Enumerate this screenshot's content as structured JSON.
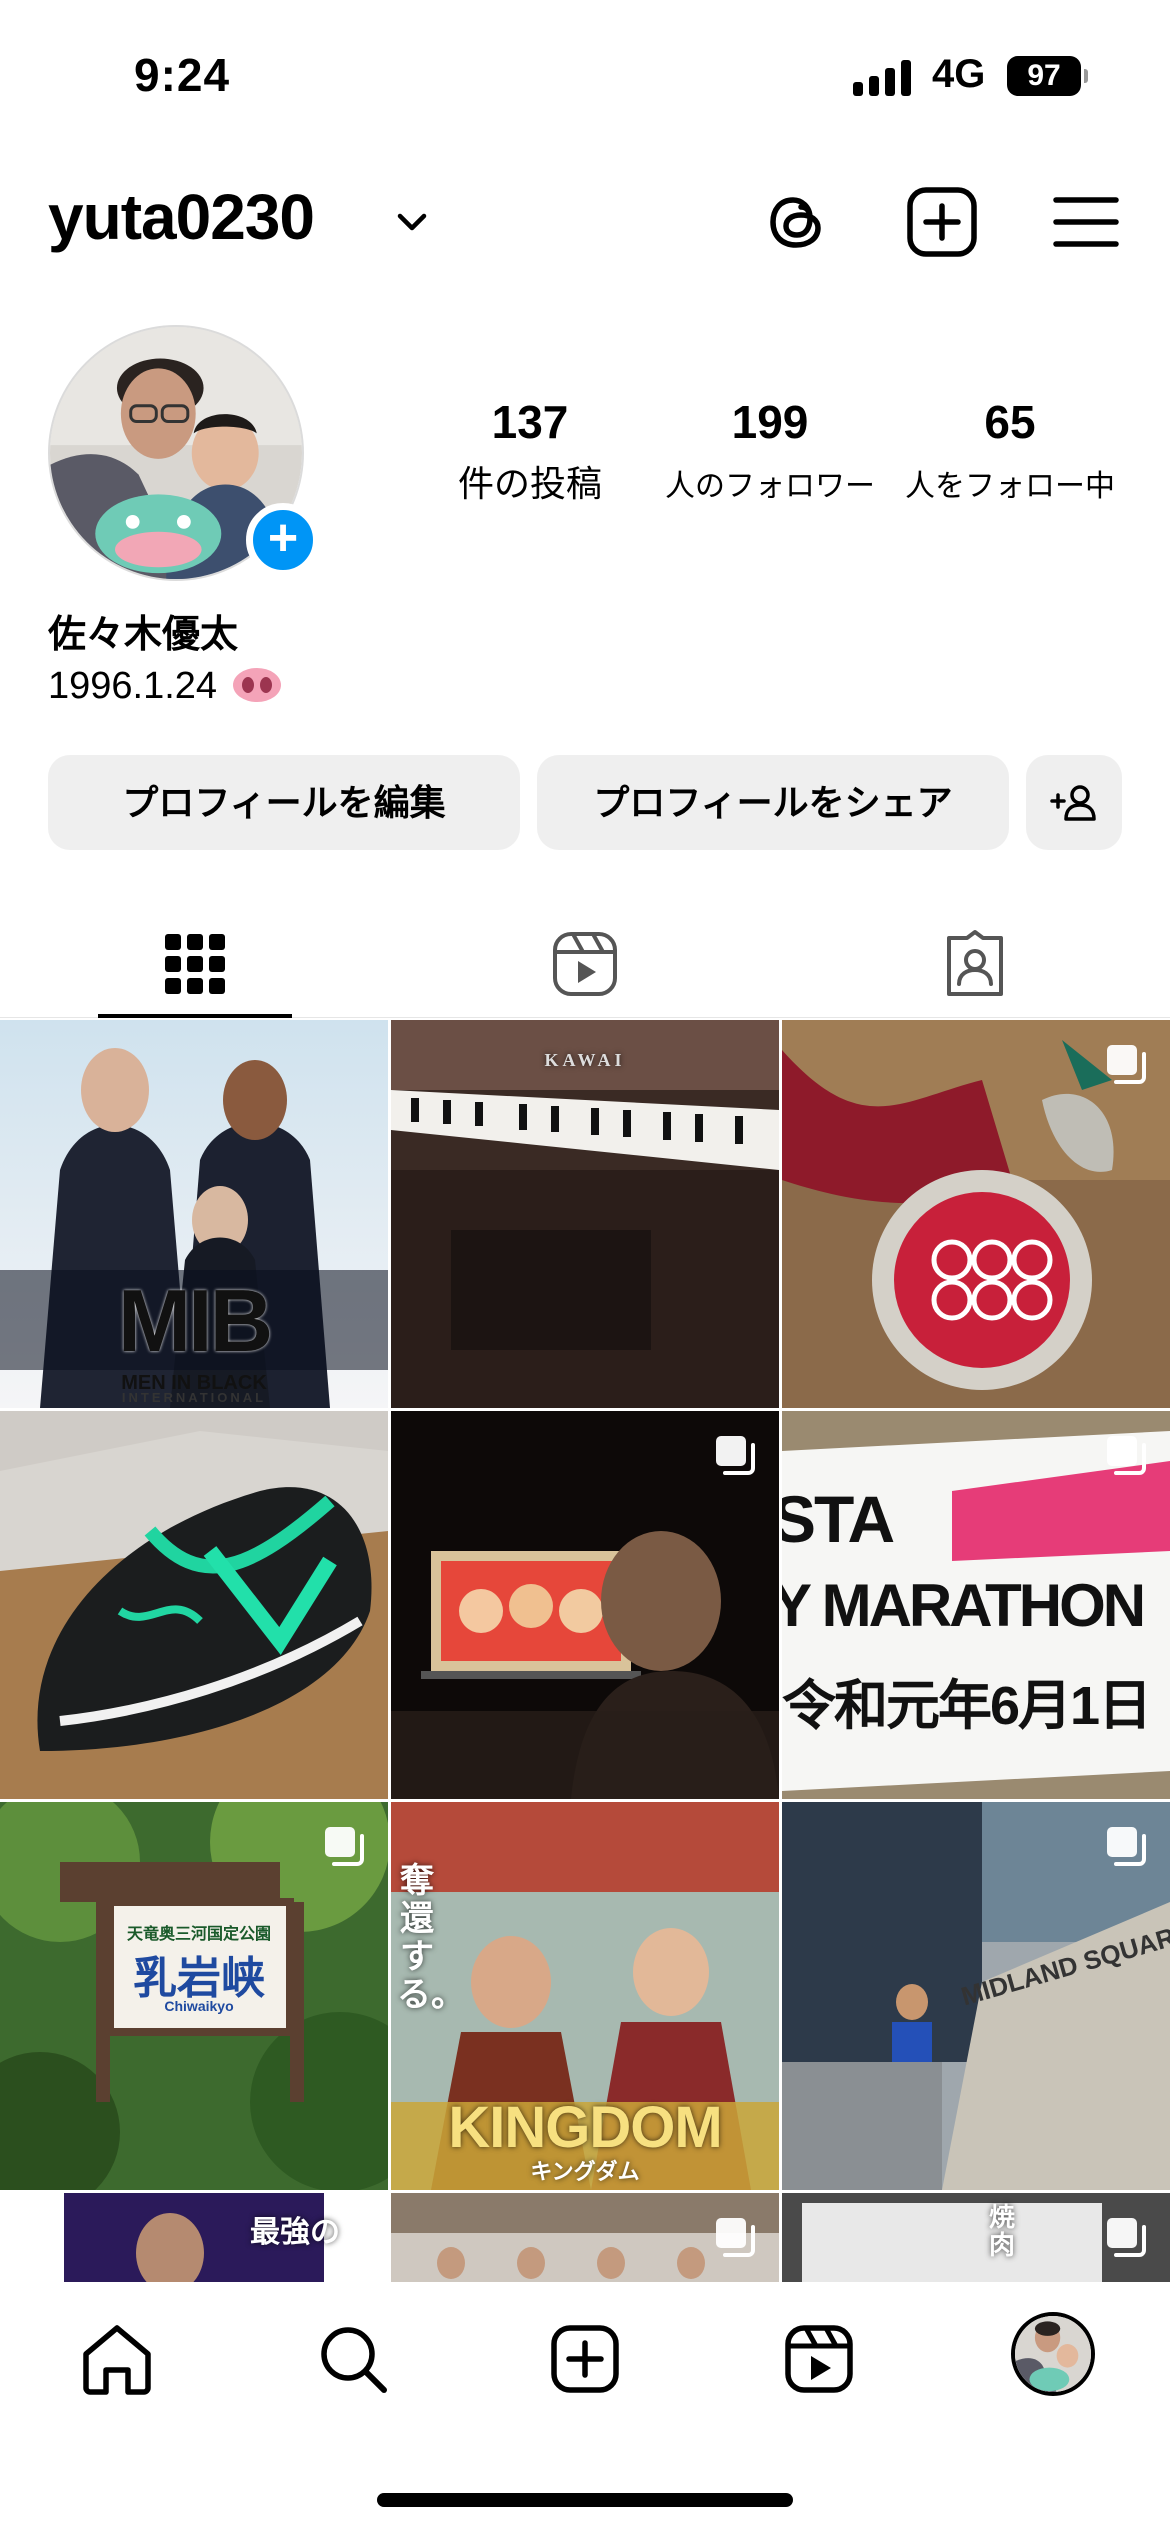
{
  "status": {
    "time": "9:24",
    "network": "4G",
    "battery": "97"
  },
  "header": {
    "username": "yuta0230",
    "icons": [
      "threads-icon",
      "create-post-icon",
      "menu-icon"
    ]
  },
  "profile": {
    "posts_count": "137",
    "posts_label": "件の投稿",
    "followers_count": "199",
    "followers_label": "人のフォロワー",
    "following_count": "65",
    "following_label": "人をフォロー中",
    "name": "佐々木優太",
    "bio": "1996.1.24",
    "add_story_label": "+"
  },
  "actions": {
    "edit_profile": "プロフィールを編集",
    "share_profile": "プロフィールをシェア",
    "suggest_icon": "add-person-icon"
  },
  "tabs": [
    {
      "name": "grid",
      "icon": "grid-icon",
      "active": true
    },
    {
      "name": "reels",
      "icon": "reels-icon",
      "active": false
    },
    {
      "name": "tagged",
      "icon": "tagged-icon",
      "active": false
    }
  ],
  "posts": [
    {
      "caption_main": "MIB",
      "caption_sub": "MEN IN BLACK",
      "caption_sub2": "INTERNATIONAL",
      "multiple": false
    },
    {
      "caption_main": "KAWAI",
      "multiple": false
    },
    {
      "caption_main": "",
      "multiple": true
    },
    {
      "caption_main": "",
      "multiple": false
    },
    {
      "caption_main": "",
      "multiple": true
    },
    {
      "caption_main": "STA",
      "caption_sub": "Y MARATHON",
      "caption_sub2": "令和元年6月1日",
      "multiple": true
    },
    {
      "caption_main": "乳岩峡",
      "caption_sub": "天竜奥三河国定公園",
      "caption_sub2": "Chiwaikyo",
      "multiple": true
    },
    {
      "caption_main": "KINGDOM",
      "caption_sub": "キングダム",
      "caption_sub2": "奪還する。",
      "multiple": false
    },
    {
      "caption_main": "MIDLAND SQUARE",
      "multiple": true
    },
    {
      "caption_main": "最強の",
      "multiple": false
    },
    {
      "caption_main": "",
      "multiple": true
    },
    {
      "caption_main": "焼肉",
      "multiple": true
    }
  ],
  "bottom_nav": [
    "home-icon",
    "search-icon",
    "create-icon",
    "reels-icon",
    "profile-avatar"
  ]
}
